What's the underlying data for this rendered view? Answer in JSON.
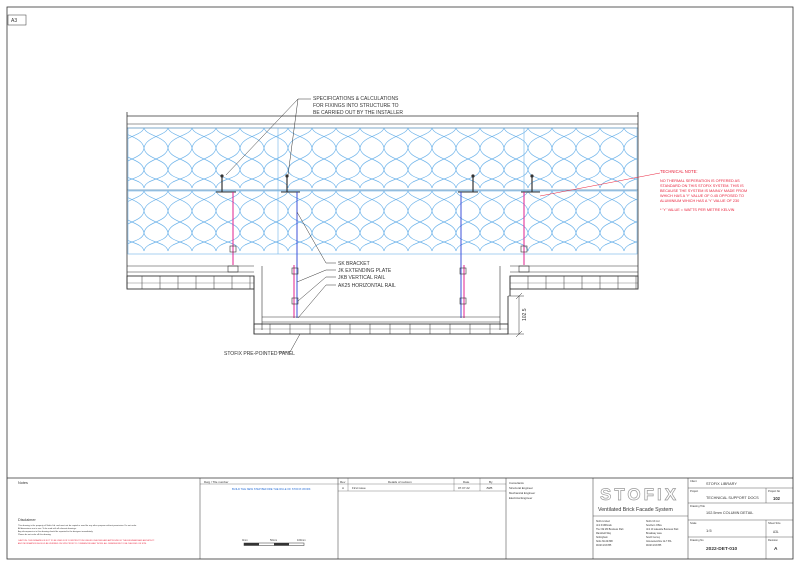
{
  "sheet": {
    "size_tag": "A3"
  },
  "callouts": {
    "spec_note": [
      "SPECIFICATIONS & CALCULATIONS",
      "FOR FIXINGS INTO STRUCTURE TO",
      "BE CARRIED OUT BY THE INSTALLER"
    ],
    "bracket": "SK BRACKET",
    "extending_plate": "JK EXTENDING PLATE",
    "vertical_rail": "JKB VERTICAL RAIL",
    "horizontal_rail": "AK25 HORIZONTAL RAIL",
    "panel": "STOFIX PRE-POINTED PANEL",
    "dimension": "102.5"
  },
  "technical_note": {
    "title": "TECHNICAL NOTE:",
    "lines": [
      "NO THERMAL SEPERATION IS OFFERED AS",
      "STANDARD ON THIS STOFIX SYSTEM. THIS IS",
      "BECAUSE THE SYSTEM IS MAINLY MADE FROM",
      "WHICH HAS A 'Y' VALUE OF 0.45 OPPOSED TO",
      "ALUMINIUM WHICH HAS A 'Y' VALUE OF 230"
    ],
    "footnote": "* 'Y' VALUE = WATTS PER METRE KELVIN"
  },
  "title_block": {
    "notes_label": "Notes",
    "disclaimer_label": "Disclaimer",
    "disclaimer_lines": [
      "This drawing is the property of Stofix Ltd. and must not be copied or used for any other purpose without permission. Do not scale.",
      "All dimensions are in mm. To be read with all relevant drawings.",
      "Any discrepancies in this drawing should be reported to the designer immediately.",
      "Please do not scale off this drawing."
    ],
    "warning_lines": [
      "CAUTION: THIS DRAWING IS NOT TO BE USED FOR CONSTRUCTION UNLESS CHECKED AND APPROVED BY THE ENGINEER AND ARCHITECT.",
      "ANY INFORMATION SHOULD BE VERIFIED ON SITE PRIOR TO COMMENCING ANY WORK. ALL DIMENSIONS TO BE CHECKED ON SITE."
    ],
    "dwg_title_header": "Dwg / Ttle number",
    "dwg_link": "BUILD THE NEW STEP BEFORE THE RULE OF STOFIX WORK",
    "scale_bar": {
      "labels": [
        "0mm",
        "50mm",
        "100mm"
      ]
    },
    "revision_headers": {
      "rev": "Rev",
      "details": "Details of revision",
      "date": "Date",
      "by": "By"
    },
    "revision_row": {
      "rev": "A",
      "details": "First issue",
      "date": "07.07.22",
      "by": "JWB"
    },
    "consultants": [
      "Consultants",
      "Structural Engineer",
      "Mechanical Engineer",
      "Electrical Engineer"
    ],
    "brand": {
      "logo": "STOFIX",
      "tagline": "Ventilated Brick Facade System"
    },
    "contact_left": [
      "Stofix Limited",
      "Unit 6 Millbrook",
      "The Old Mill Business Park",
      "Mansfield Way",
      "Nottingham",
      "Notts NG19 8RF",
      "01623 233 855"
    ],
    "contact_right": [
      "Stofix UK Ltd",
      "Southern Office",
      "Unit 10 Lakeside Business Park",
      "Broadway Lane",
      "South Cerney",
      "Gloucestershire GL7 5XL",
      "01623 233 855"
    ],
    "client_label": "Client",
    "client": "STOFIX LIBRARY",
    "project_label": "Project",
    "project_no_label": "Project No",
    "project": "TECHNICAL SUPPORT DOCS",
    "project_no": "102",
    "drawing_title_label": "Drawing Title",
    "drawing_title": "102.5mm COLUMN DETAIL",
    "scale_label": "Scale",
    "scale": "1:5",
    "sheet_label": "Sheet Size",
    "sheet": "A3L",
    "drawing_no_label": "Drawing No",
    "revision_label": "Revision",
    "drawing_no": "2022-DET-010",
    "revision": "A"
  },
  "colors": {
    "insulation": "#6fb4ea",
    "magenta": "#e0208f",
    "red_note": "#e8203a",
    "rail_blue": "#2a3fd6",
    "logo_grey": "#9a9a9a"
  }
}
